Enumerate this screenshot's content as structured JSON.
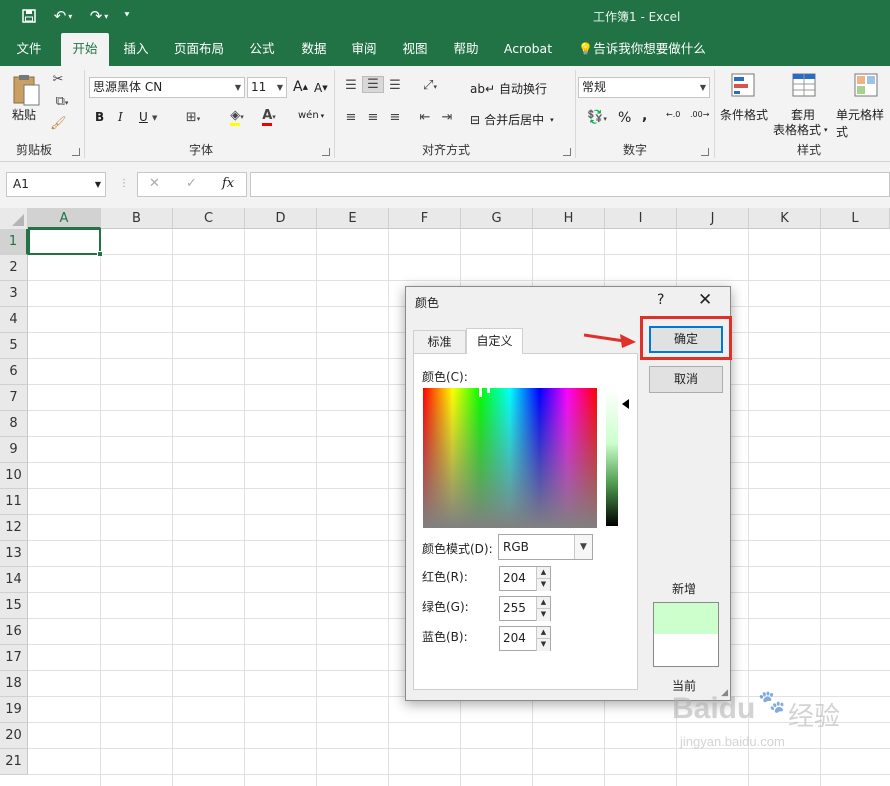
{
  "window": {
    "title": "工作簿1  -  Excel",
    "accent": "#217346"
  },
  "qat": {
    "save_icon": "save-icon",
    "undo_icon": "undo-icon",
    "redo_icon": "redo-icon",
    "customize_icon": "customize-icon"
  },
  "menu": [
    "文件",
    "开始",
    "插入",
    "页面布局",
    "公式",
    "数据",
    "审阅",
    "视图",
    "帮助",
    "Acrobat",
    "告诉我你想要做什么"
  ],
  "ribbon": {
    "clipboard": {
      "paste": "粘贴",
      "label": "剪贴板"
    },
    "font": {
      "name": "思源黑体 CN",
      "size": "11",
      "grow": "A",
      "shrink": "A",
      "bold": "B",
      "italic": "I",
      "underline": "U",
      "phonetic": "wén",
      "label": "字体"
    },
    "alignment": {
      "wrap": "自动换行",
      "merge": "合并后居中",
      "label": "对齐方式"
    },
    "number": {
      "format": "常规",
      "percent": "%",
      "comma": ",",
      "inc": "←.0\n.00",
      "dec": ".00\n→.0",
      "label": "数字"
    },
    "styles": {
      "conditional": "条件格式",
      "table": "套用",
      "table2": "表格格式",
      "cell": "单元格样式",
      "label": "样式"
    }
  },
  "formula_bar": {
    "name_box": "A1",
    "fx": "fx",
    "cancel": "✕",
    "enter": "✓",
    "value": ""
  },
  "sheet": {
    "columns": [
      "A",
      "B",
      "C",
      "D",
      "E",
      "F",
      "G",
      "H",
      "I",
      "J",
      "K",
      "L"
    ],
    "rows": [
      "1",
      "2",
      "3",
      "4",
      "5",
      "6",
      "7",
      "8",
      "9",
      "10",
      "11",
      "12",
      "13",
      "14",
      "15",
      "16",
      "17",
      "18",
      "19",
      "20",
      "21"
    ],
    "active_cell": "A1"
  },
  "dialog": {
    "title": "颜色",
    "help": "?",
    "close": "✕",
    "tabs": [
      "标准",
      "自定义"
    ],
    "active_tab": "自定义",
    "colors_label": "颜色(C):",
    "mode_label": "颜色模式(D):",
    "mode_value": "RGB",
    "red_label": "红色(R):",
    "green_label": "绿色(G):",
    "blue_label": "蓝色(B):",
    "red_value": "204",
    "green_value": "255",
    "blue_value": "204",
    "ok": "确定",
    "cancel": "取消",
    "new_label": "新增",
    "current_label": "当前",
    "new_color": "#ccffcc",
    "current_color": "#ffffff"
  },
  "annotation": {
    "highlight_color": "#e0302a"
  },
  "watermark": {
    "brand": "Baidu",
    "text": "经验",
    "url": "jingyan.baidu.com"
  }
}
